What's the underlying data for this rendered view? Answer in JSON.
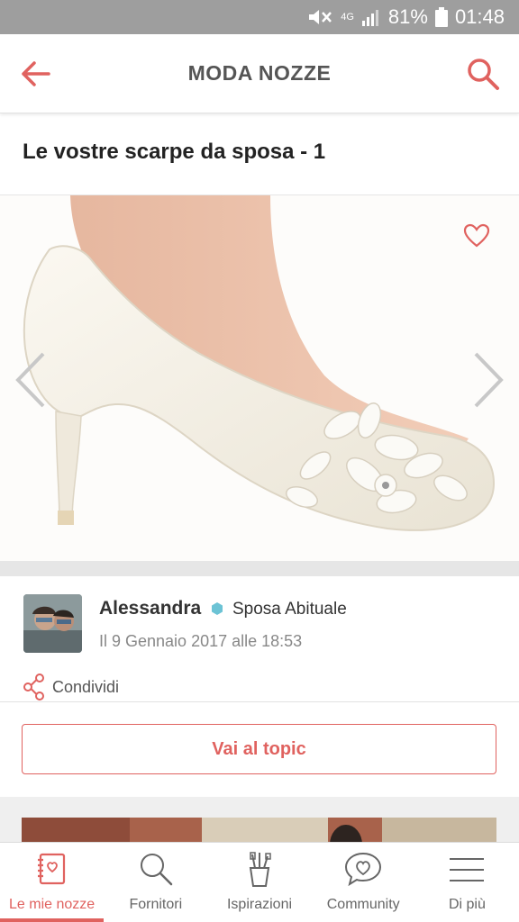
{
  "status_bar": {
    "network": "4G",
    "battery": "81%",
    "time": "01:48"
  },
  "app_bar": {
    "title": "MODA NOZZE",
    "back_icon": "arrow-left-icon",
    "search_icon": "search-icon"
  },
  "post": {
    "title": "Le vostre scarpe da sposa - 1"
  },
  "author": {
    "name": "Alessandra",
    "badge": "Sposa Abituale",
    "date": "Il 9 Gennaio 2017 alle 18:53"
  },
  "share": {
    "label": "Condividi"
  },
  "topic_button": {
    "label": "Vai al topic"
  },
  "bottom_nav": [
    {
      "label": "Le mie nozze",
      "icon": "notebook-icon",
      "active": true
    },
    {
      "label": "Fornitori",
      "icon": "search-icon",
      "active": false
    },
    {
      "label": "Ispirazioni",
      "icon": "brushes-icon",
      "active": false
    },
    {
      "label": "Community",
      "icon": "chat-heart-icon",
      "active": false
    },
    {
      "label": "Di più",
      "icon": "menu-icon",
      "active": false
    }
  ],
  "colors": {
    "accent": "#e0625f",
    "status_bar": "#9e9e9e",
    "badge": "#6cc3d5"
  }
}
